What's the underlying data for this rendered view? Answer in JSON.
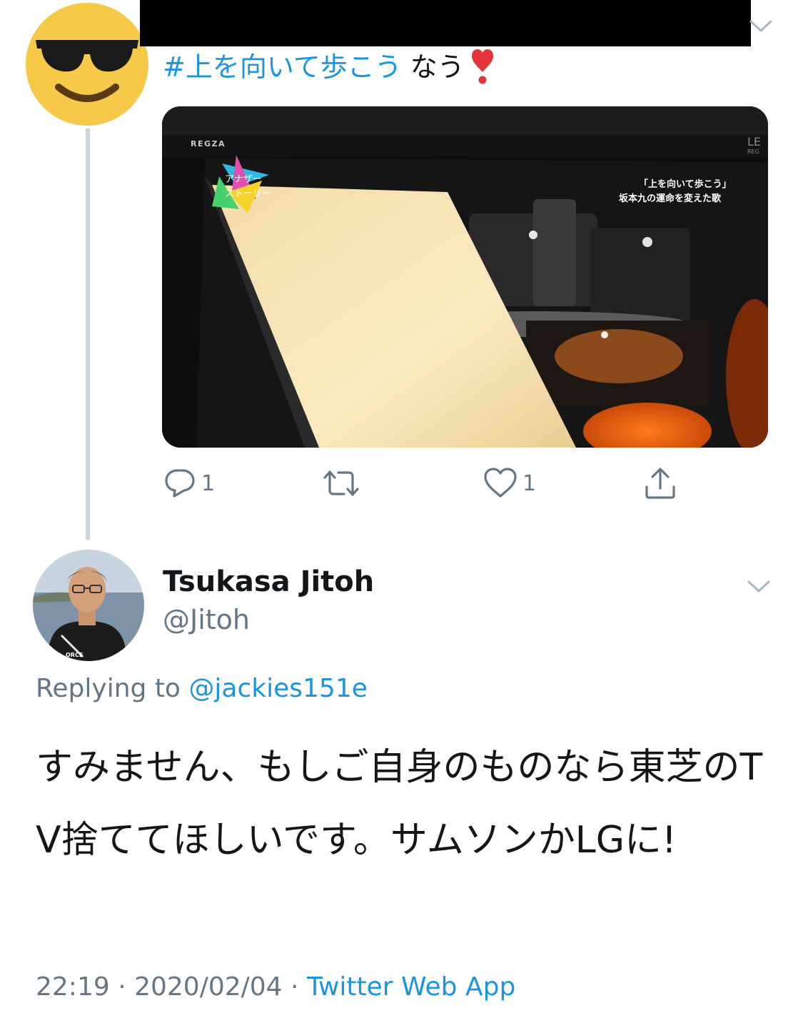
{
  "parent_tweet": {
    "hashtag": "#上を向いて歩こう",
    "text_suffix": " なう",
    "heart_emoji": "heavy-red-exclamation-heart",
    "media": {
      "tv_brand": "REGZA",
      "corner_brand": "LE",
      "corner_brand_sub": "REG",
      "logo_text_1": "アナザー",
      "logo_text_2": "ストーリー",
      "caption_line_1": "「上を向いて歩こう」",
      "caption_line_2": "坂本九の運命を変えた歌"
    },
    "actions": {
      "reply_count": "1",
      "like_count": "1"
    }
  },
  "reply_tweet": {
    "display_name": "Tsukasa Jitoh",
    "handle": "@Jitoh",
    "replying_prefix": "Replying to ",
    "replying_handle": "@jackies151e",
    "body": "すみません、もしご自身のものなら東芝のTV捨ててほしいです。サムソンかLGに!",
    "time": "22:19",
    "separator": " · ",
    "date": "2020/02/04",
    "source": "Twitter Web App",
    "avatar_shirt_text": "ORCE"
  },
  "colors": {
    "link_blue": "#1b95e0",
    "secondary_gray": "#657786",
    "text_black": "#14171a",
    "thread_line": "#cdd5dd",
    "emoji_yellow": "#f7c948"
  }
}
